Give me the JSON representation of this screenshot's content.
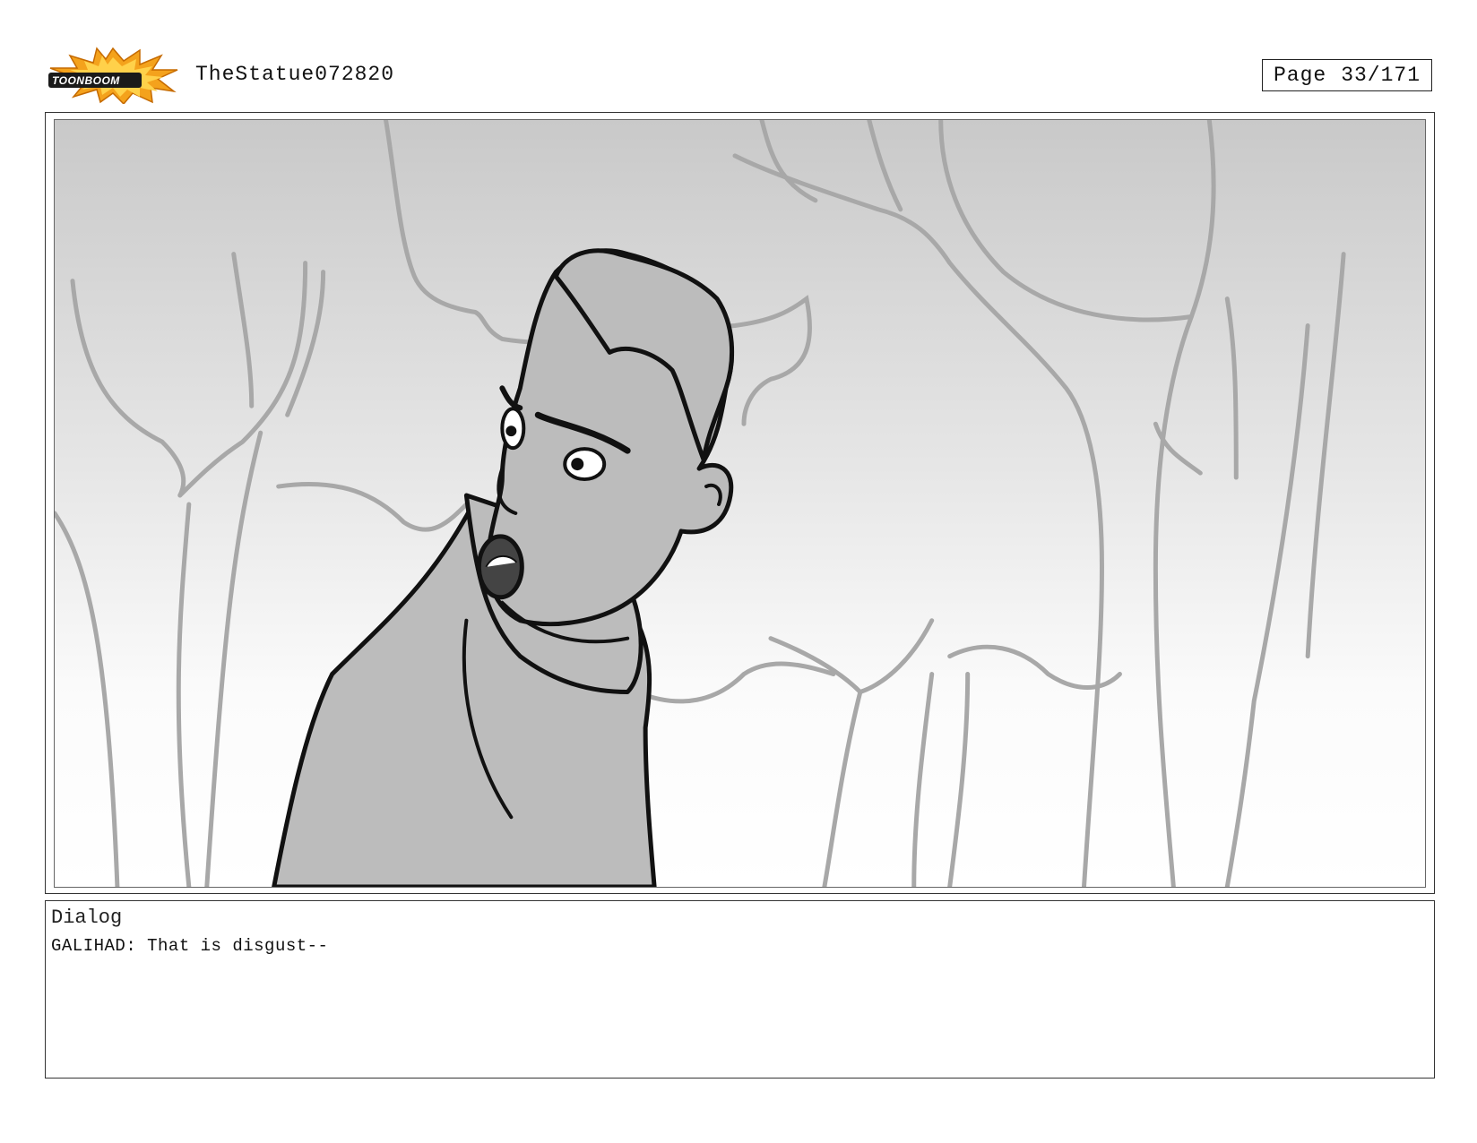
{
  "header": {
    "logo_text": "TOONBOOM",
    "project_title": "TheStatue072820",
    "page_label": "Page",
    "page_number": "33/171"
  },
  "panel": {
    "image_icon": "storyboard-sketch-character-in-forest"
  },
  "dialog": {
    "label": "Dialog",
    "text": "GALIHAD: That is disgust--"
  },
  "colors": {
    "logo_burst": "#f4a21c",
    "logo_outline": "#1a1a1a",
    "sketch_gray": "#a8a8a8",
    "character_fill": "#bcbcbc",
    "line_black": "#111111"
  }
}
